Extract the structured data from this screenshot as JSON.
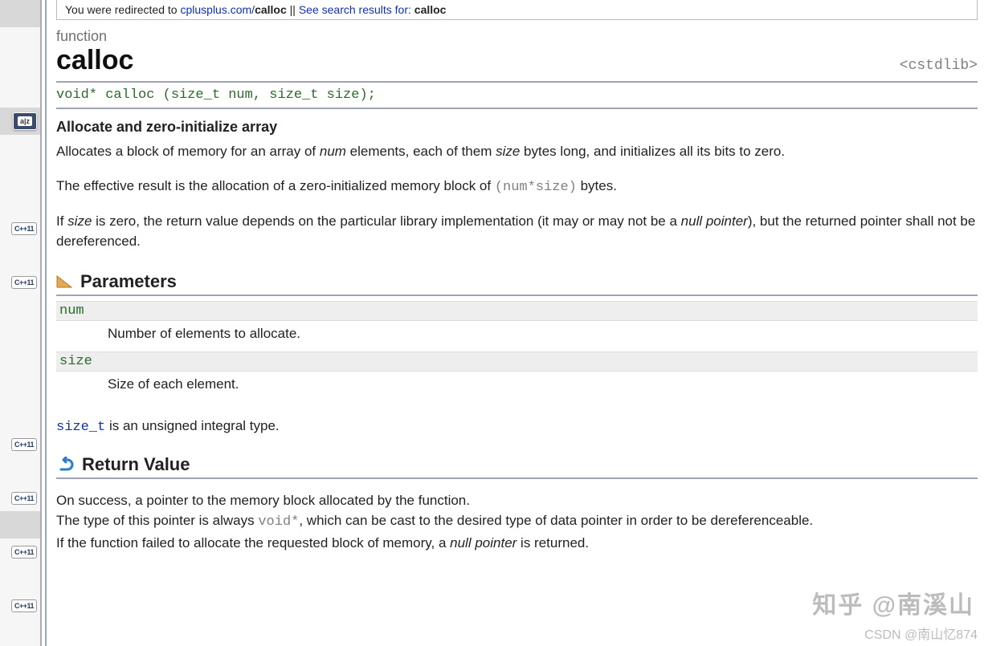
{
  "sidebar": {
    "az_label": "a|z",
    "cpp_label": "C++11"
  },
  "topbar": {
    "prefix": "You were redirected to ",
    "site": "cplusplus.com/",
    "kw": "calloc",
    "mid": " || ",
    "link": "See search results for: ",
    "term": "calloc"
  },
  "header": {
    "kind": "function",
    "name": "calloc",
    "lib": "<cstdlib>"
  },
  "signature": "void* calloc (size_t num, size_t size);",
  "brief": "Allocate and zero-initialize array",
  "desc": {
    "p1a": "Allocates a block of memory for an array of ",
    "p1_num": "num",
    "p1b": " elements, each of them ",
    "p1_size": "size",
    "p1c": " bytes long, and initializes all its bits to zero.",
    "p2a": "The effective result is the allocation of a zero-initialized memory block of ",
    "p2_code": "(num*size)",
    "p2b": " bytes.",
    "p3a": "If ",
    "p3_size": "size",
    "p3b": " is zero, the return value depends on the particular library implementation (it may or may not be a ",
    "p3_np": "null pointer",
    "p3c": "), but the returned pointer shall not be dereferenced."
  },
  "params": {
    "heading": "Parameters",
    "items": [
      {
        "name": "num",
        "text": "Number of elements to allocate."
      },
      {
        "name": "size",
        "text": "Size of each element."
      }
    ],
    "note_type": "size_t",
    "note_text": " is an unsigned integral type."
  },
  "retval": {
    "heading": "Return Value",
    "l1": "On success, a pointer to the memory block allocated by the function.",
    "l2a": "The type of this pointer is always ",
    "l2_code": "void*",
    "l2b": ", which can be cast to the desired type of data pointer in order to be dereferenceable.",
    "l3a": "If the function failed to allocate the requested block of memory, a ",
    "l3_np": "null pointer",
    "l3b": " is returned."
  },
  "watermark": {
    "w1": "知乎 @南溪山",
    "w2": "CSDN @南山忆874"
  }
}
